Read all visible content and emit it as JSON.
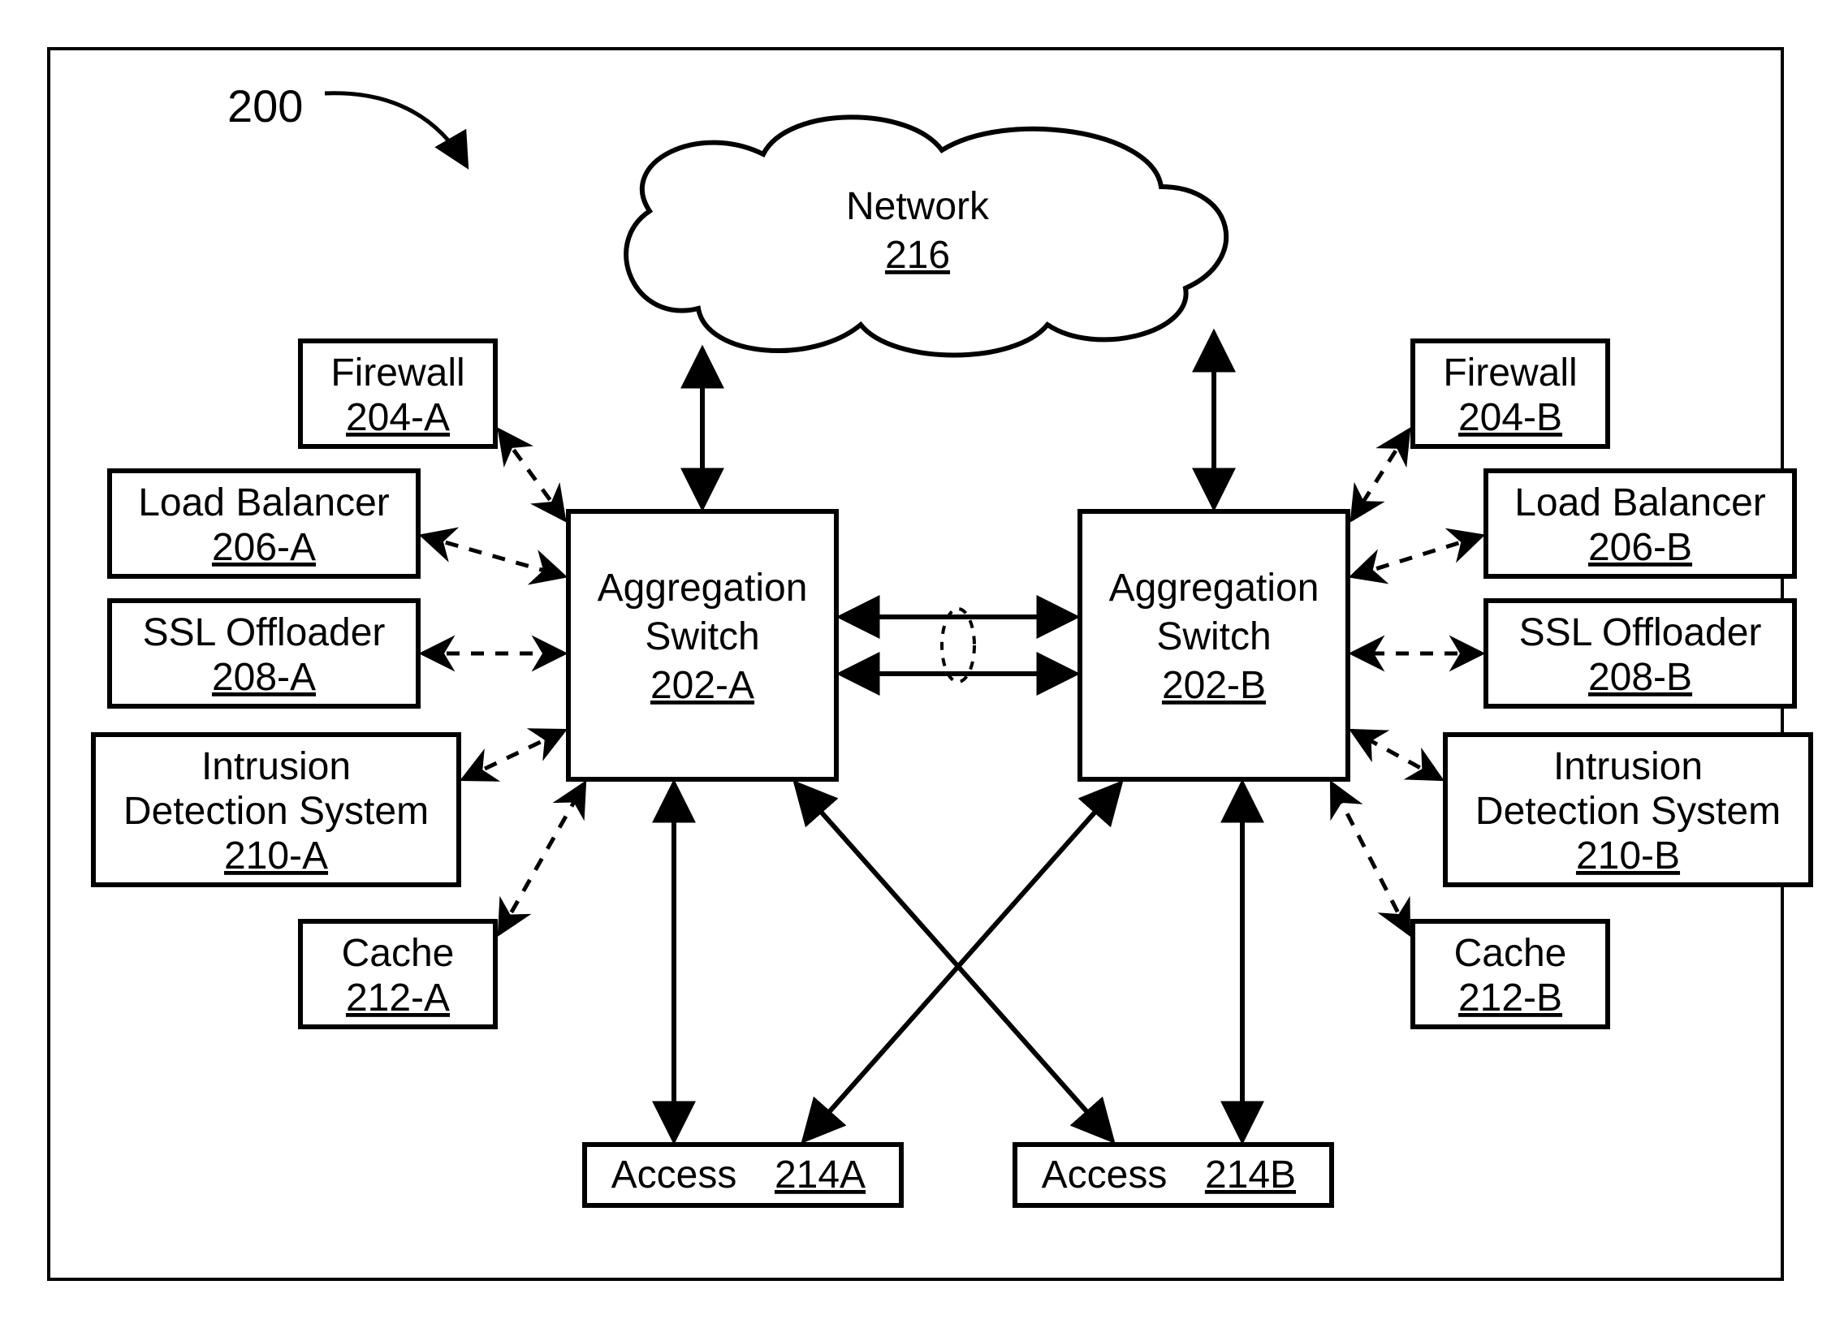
{
  "figure_ref": "200",
  "nodes": {
    "network": {
      "label": "Network",
      "ref": "216"
    },
    "aggA": {
      "label": "Aggregation Switch",
      "ref": "202-A"
    },
    "aggB": {
      "label": "Aggregation Switch",
      "ref": "202-B"
    },
    "fwA": {
      "label": "Firewall",
      "ref": "204-A"
    },
    "fwB": {
      "label": "Firewall",
      "ref": "204-B"
    },
    "lbA": {
      "label": "Load Balancer",
      "ref": "206-A"
    },
    "lbB": {
      "label": "Load Balancer",
      "ref": "206-B"
    },
    "sslA": {
      "label": "SSL Offloader",
      "ref": "208-A"
    },
    "sslB": {
      "label": "SSL Offloader",
      "ref": "208-B"
    },
    "idsA": {
      "label": "Intrusion Detection System",
      "ref": "210-A"
    },
    "idsB": {
      "label": "Intrusion Detection System",
      "ref": "210-B"
    },
    "cacheA": {
      "label": "Cache",
      "ref": "212-A"
    },
    "cacheB": {
      "label": "Cache",
      "ref": "212-B"
    },
    "accA": {
      "label": "Access",
      "ref": "214A"
    },
    "accB": {
      "label": "Access",
      "ref": "214B"
    }
  }
}
